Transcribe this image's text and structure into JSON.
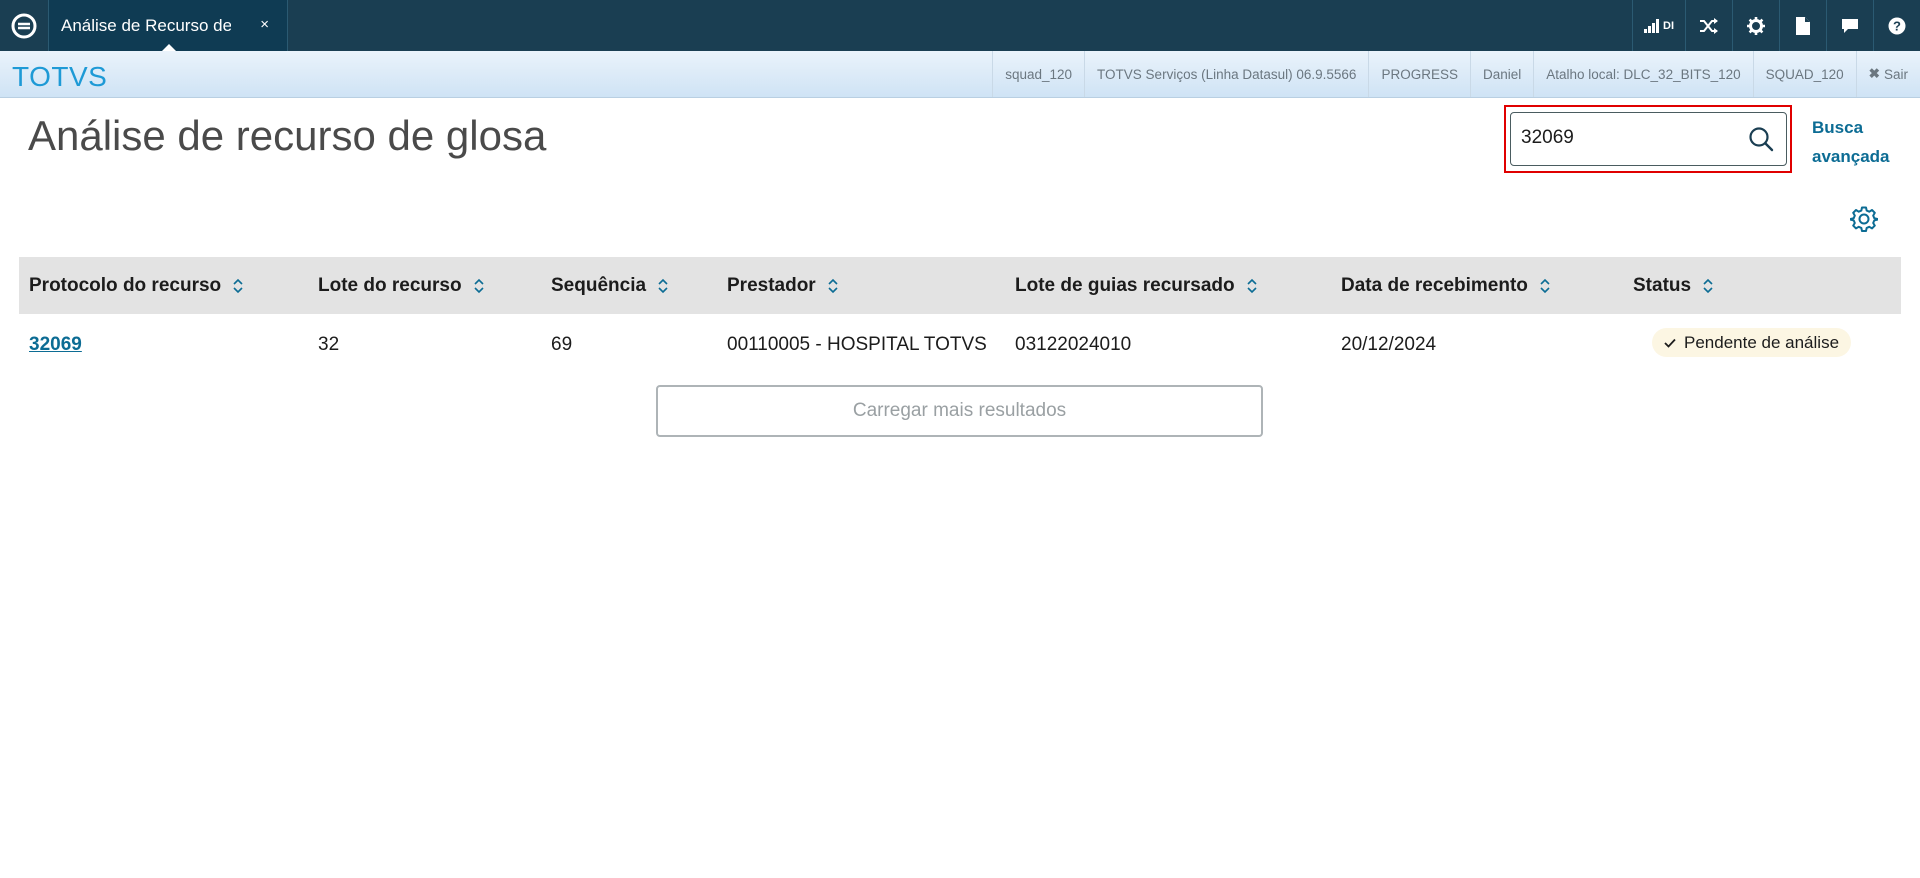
{
  "topbar": {
    "tab_label": "Análise de Recurso de",
    "tab_close": "×",
    "signal_text": "DI"
  },
  "subbar": {
    "brand": "TOTVS",
    "info": [
      "squad_120",
      "TOTVS Serviços (Linha Datasul) 06.9.5566",
      "PROGRESS",
      "Daniel",
      "Atalho local: DLC_32_BITS_120",
      "SQUAD_120"
    ],
    "logout": "Sair"
  },
  "page": {
    "title": "Análise de recurso de glosa",
    "search_value": "32069",
    "advanced_search_line1": "Busca",
    "advanced_search_line2": "avançada"
  },
  "table": {
    "columns": [
      "Protocolo do recurso",
      "Lote do recurso",
      "Sequência",
      "Prestador",
      "Lote de guias recursado",
      "Data de recebimento",
      "Status"
    ],
    "rows": [
      {
        "protocolo": "32069",
        "lote": "32",
        "sequencia": "69",
        "prestador": "00110005 - HOSPITAL TOTVS",
        "lote_guias": "03122024010",
        "data": "20/12/2024",
        "status": "Pendente de análise"
      }
    ],
    "load_more": "Carregar mais resultados"
  },
  "colors": {
    "topbar": "#1a3e52",
    "brand": "#1e9ad6",
    "link": "#0c6c94",
    "highlight": "#e00000",
    "badge_bg": "#fcf6e3"
  },
  "icons": [
    "totvs-logo-icon",
    "signal-icon",
    "shuffle-icon",
    "gear-icon",
    "document-icon",
    "chat-icon",
    "help-icon",
    "search-icon",
    "settings-icon",
    "sort-icon",
    "check-icon"
  ]
}
